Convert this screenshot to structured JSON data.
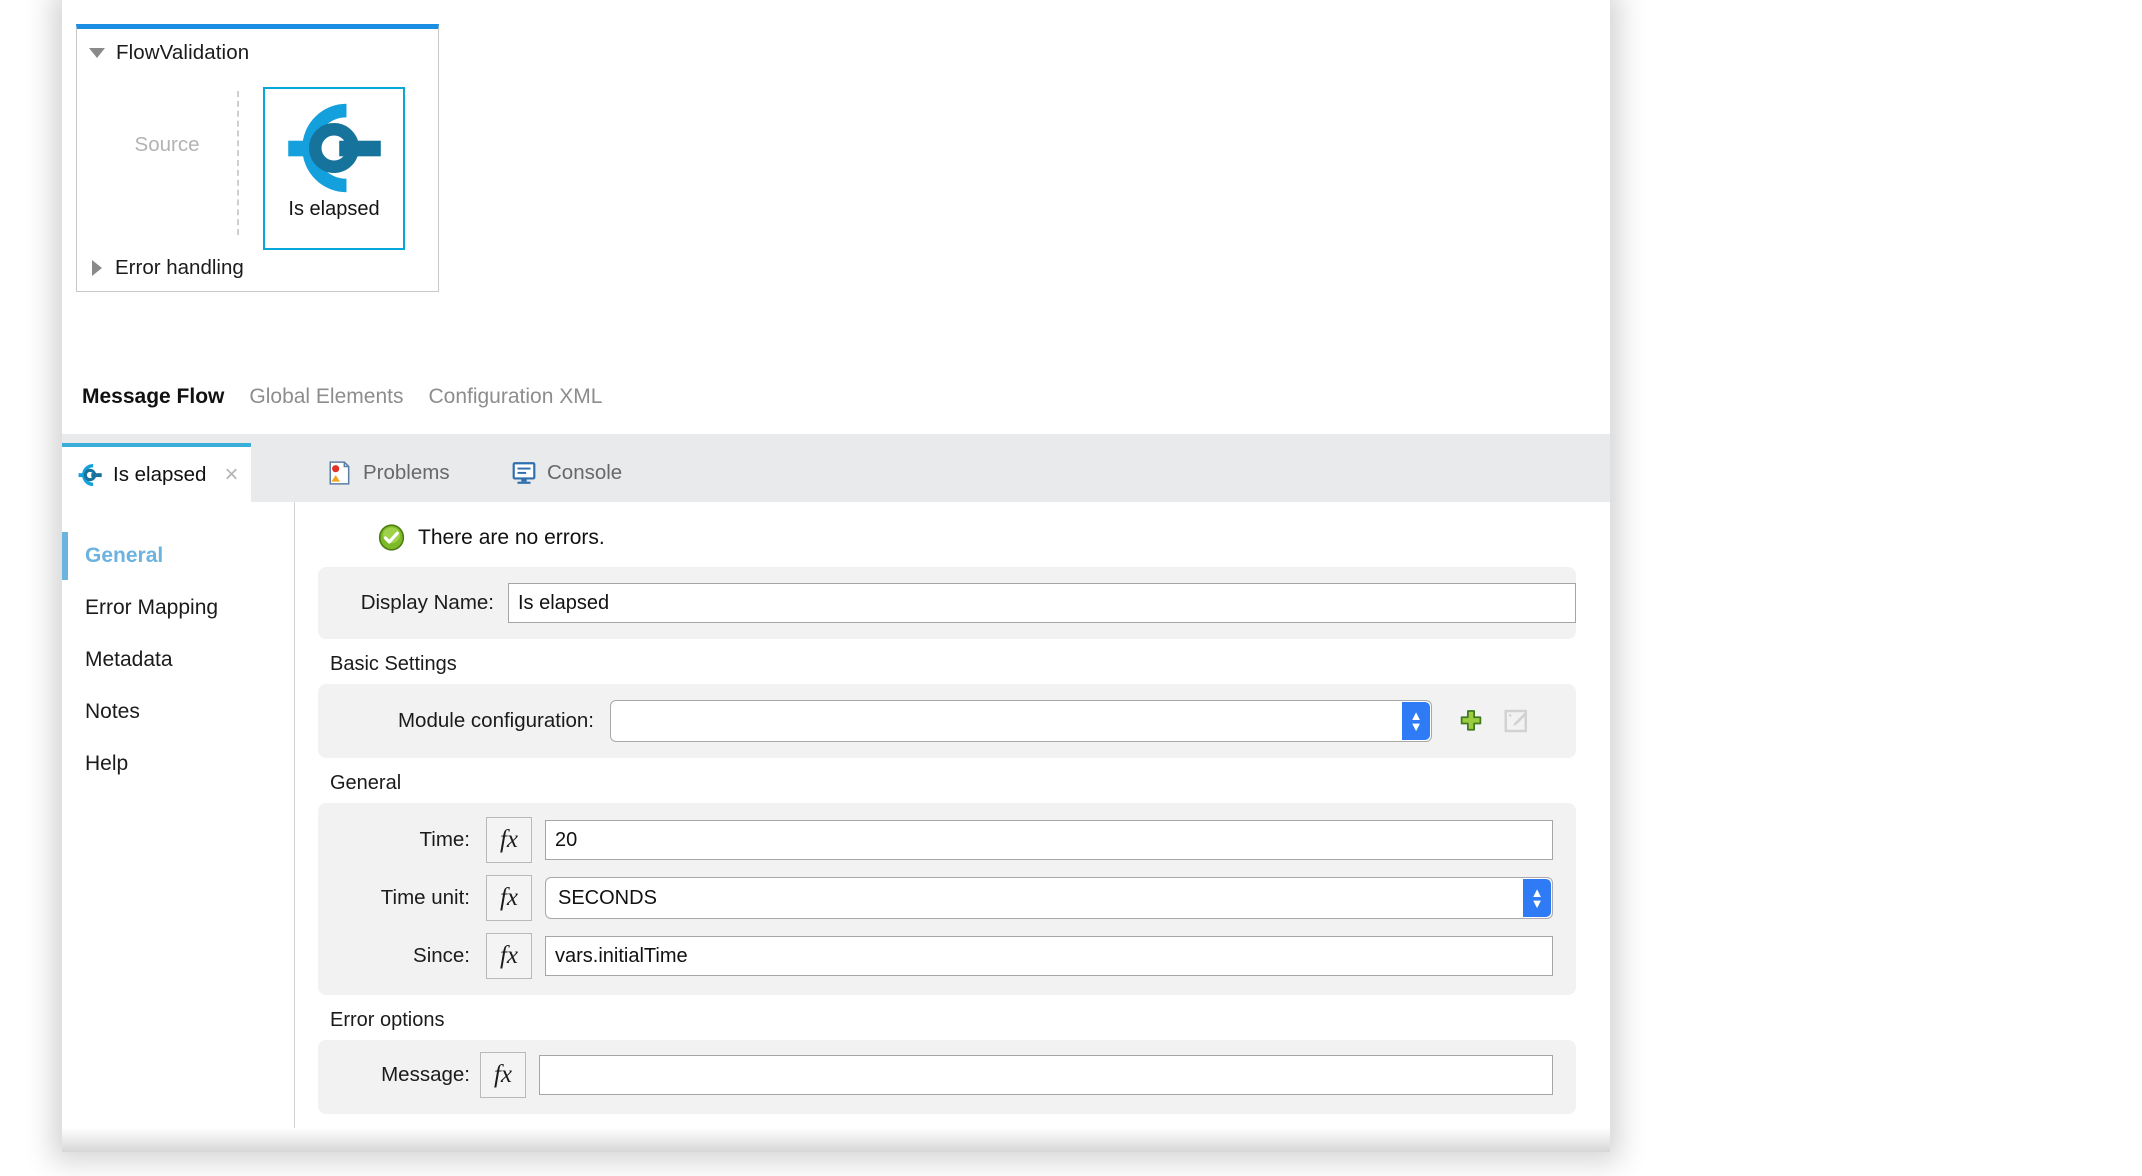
{
  "canvas": {
    "flow": {
      "name": "FlowValidation",
      "expand_icon": "triangle-down-icon",
      "source_label": "Source",
      "node": {
        "label": "Is elapsed",
        "icon": "is-elapsed-icon",
        "selected": true
      },
      "error_handling": {
        "label": "Error handling",
        "expand_icon": "triangle-right-icon"
      }
    },
    "mode_tabs": [
      {
        "label": "Message Flow",
        "active": true
      },
      {
        "label": "Global Elements",
        "active": false
      },
      {
        "label": "Configuration XML",
        "active": false
      }
    ]
  },
  "view_tabs": [
    {
      "label": "Is elapsed",
      "icon": "is-elapsed-icon",
      "active": true,
      "closable": true,
      "close_label": "×"
    },
    {
      "label": "Problems",
      "icon": "problems-icon",
      "active": false,
      "closable": false
    },
    {
      "label": "Console",
      "icon": "console-icon",
      "active": false,
      "closable": false
    }
  ],
  "properties": {
    "sidebar": [
      {
        "label": "General",
        "active": true
      },
      {
        "label": "Error Mapping",
        "active": false
      },
      {
        "label": "Metadata",
        "active": false
      },
      {
        "label": "Notes",
        "active": false
      },
      {
        "label": "Help",
        "active": false
      }
    ],
    "status": {
      "icon": "success-check-icon",
      "text": "There are no errors."
    },
    "display_name": {
      "label": "Display Name:",
      "value": "Is elapsed",
      "placeholder": ""
    },
    "basic_settings": {
      "title": "Basic Settings",
      "module_configuration": {
        "label": "Module configuration:",
        "value": "",
        "placeholder": "",
        "add_icon": "plus-icon",
        "edit_icon": "edit-pencil-icon",
        "edit_disabled": true
      }
    },
    "general": {
      "title": "General",
      "fields": [
        {
          "label": "Time:",
          "value": "20",
          "type": "text",
          "fx": "fx"
        },
        {
          "label": "Time unit:",
          "value": "SECONDS",
          "type": "combo",
          "fx": "fx"
        },
        {
          "label": "Since:",
          "value": "vars.initialTime",
          "type": "text",
          "fx": "fx"
        }
      ]
    },
    "error_options": {
      "title": "Error options",
      "fields": [
        {
          "label": "Message:",
          "value": "",
          "type": "text",
          "fx": "fx"
        }
      ]
    }
  },
  "colors": {
    "flow_accent": "#1a8fe3",
    "node_accent": "#06a7d8",
    "tab_accent": "#3aaed8",
    "sidebar_active": "#6cb3e0",
    "combo_arrow": "#2f7bf6",
    "success": "#6aa81d"
  }
}
